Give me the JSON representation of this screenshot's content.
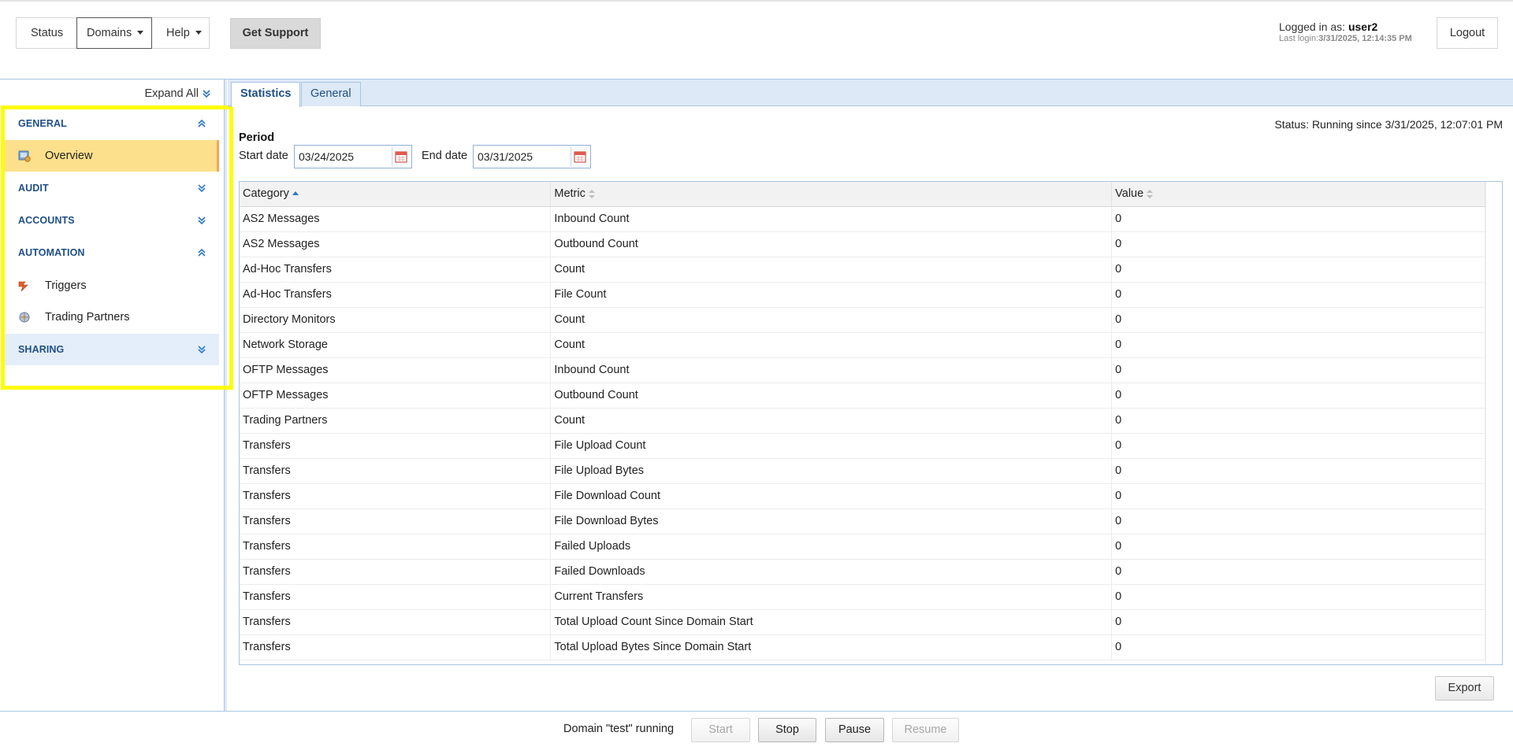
{
  "header": {
    "nav": {
      "status": "Status",
      "domains": "Domains",
      "help": "Help"
    },
    "get_support": "Get Support",
    "logged_in_prefix": "Logged in as:",
    "username": "user2",
    "last_login_prefix": "Last login:",
    "last_login_value": "3/31/2025, 12:14:35 PM",
    "logout": "Logout"
  },
  "sidebar": {
    "expand_all": "Expand All",
    "sections": {
      "general": "GENERAL",
      "audit": "AUDIT",
      "accounts": "ACCOUNTS",
      "automation": "AUTOMATION",
      "sharing": "SHARING"
    },
    "items": {
      "overview": "Overview",
      "triggers": "Triggers",
      "trading_partners": "Trading Partners"
    },
    "active_item": "Overview"
  },
  "tabs": {
    "statistics": "Statistics",
    "general": "General",
    "active": "Statistics"
  },
  "status": "Status: Running since 3/31/2025, 12:07:01 PM",
  "period": {
    "label": "Period",
    "start_label": "Start date",
    "start_value": "03/24/2025",
    "end_label": "End date",
    "end_value": "03/31/2025"
  },
  "table": {
    "headers": {
      "category": "Category",
      "metric": "Metric",
      "value": "Value"
    },
    "sorted_by": "Category",
    "rows": [
      [
        "AS2 Messages",
        "Inbound Count",
        "0"
      ],
      [
        "AS2 Messages",
        "Outbound Count",
        "0"
      ],
      [
        "Ad-Hoc Transfers",
        "Count",
        "0"
      ],
      [
        "Ad-Hoc Transfers",
        "File Count",
        "0"
      ],
      [
        "Directory Monitors",
        "Count",
        "0"
      ],
      [
        "Network Storage",
        "Count",
        "0"
      ],
      [
        "OFTP Messages",
        "Inbound Count",
        "0"
      ],
      [
        "OFTP Messages",
        "Outbound Count",
        "0"
      ],
      [
        "Trading Partners",
        "Count",
        "0"
      ],
      [
        "Transfers",
        "File Upload Count",
        "0"
      ],
      [
        "Transfers",
        "File Upload Bytes",
        "0"
      ],
      [
        "Transfers",
        "File Download Count",
        "0"
      ],
      [
        "Transfers",
        "File Download Bytes",
        "0"
      ],
      [
        "Transfers",
        "Failed Uploads",
        "0"
      ],
      [
        "Transfers",
        "Failed Downloads",
        "0"
      ],
      [
        "Transfers",
        "Current Transfers",
        "0"
      ],
      [
        "Transfers",
        "Total Upload Count Since Domain Start",
        "0"
      ],
      [
        "Transfers",
        "Total Upload Bytes Since Domain Start",
        "0"
      ]
    ]
  },
  "export": "Export",
  "footer": {
    "status_text": "Domain \"test\" running",
    "start": "Start",
    "stop": "Stop",
    "pause": "Pause",
    "resume": "Resume"
  },
  "colors": {
    "accent": "#1f4f86",
    "active_item_bg": "#fde08c",
    "highlight_box": "#fffb00",
    "tab_bar_bg": "#dde9f6"
  }
}
